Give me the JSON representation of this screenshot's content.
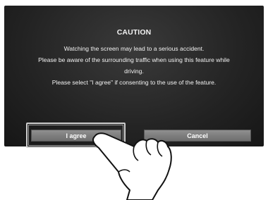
{
  "dialog": {
    "title": "CAUTION",
    "lines": [
      "Watching the screen may lead to a serious accident.",
      "Please be aware of the surrounding traffic when using this feature while",
      "driving.",
      "Please select \"I agree\" if consenting to the use of the feature."
    ]
  },
  "buttons": {
    "agree": "I agree",
    "cancel": "Cancel"
  },
  "icons": {
    "pointer": "pointing-hand-icon"
  }
}
